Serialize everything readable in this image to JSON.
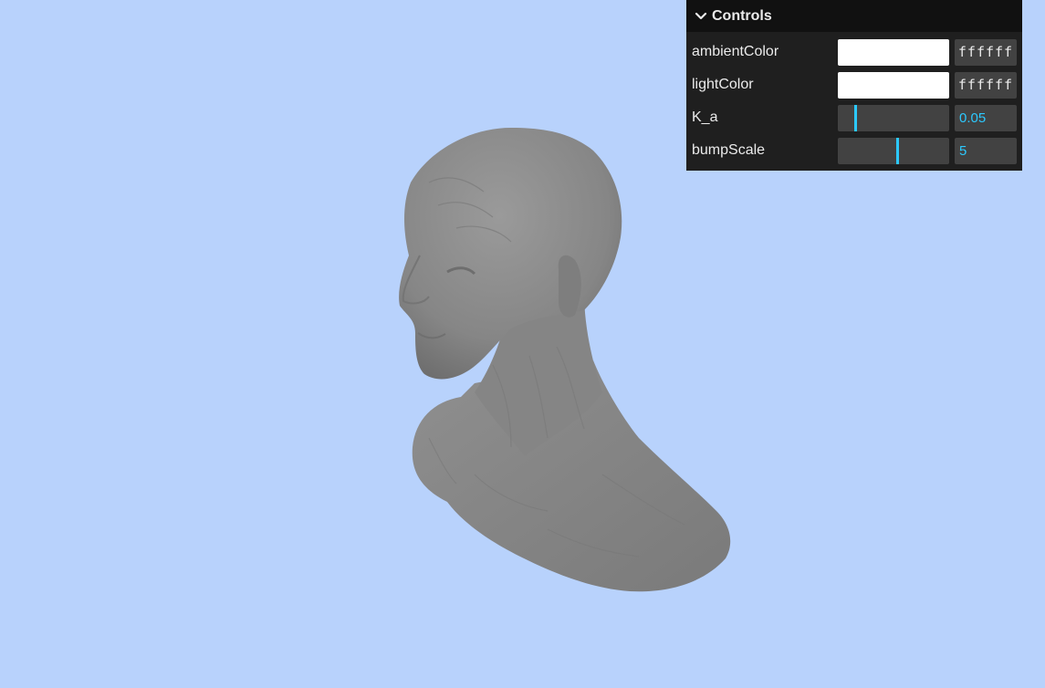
{
  "panel": {
    "title": "Controls",
    "controls": {
      "ambientColor": {
        "label": "ambientColor",
        "value": "ffffff",
        "color": "#ffffff"
      },
      "lightColor": {
        "label": "lightColor",
        "value": "ffffff",
        "color": "#ffffff"
      },
      "K_a": {
        "label": "K_a",
        "value": "0.05",
        "fraction": 0.1
      },
      "bumpScale": {
        "label": "bumpScale",
        "value": "5",
        "fraction": 0.5
      }
    }
  },
  "scene": {
    "background": "#b8d2fc",
    "model_color": "#8a8a8a",
    "accent": "#2cc9ff"
  }
}
